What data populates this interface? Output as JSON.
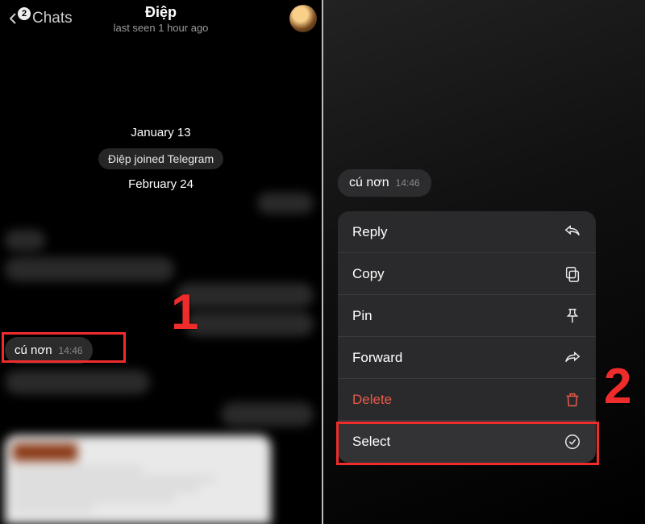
{
  "left": {
    "back_label": "Chats",
    "back_count": "2",
    "title": "Điệp",
    "subtitle": "last seen 1 hour ago",
    "date1": "January 13",
    "joined": "Điệp joined Telegram",
    "date2": "February 24",
    "hi_bubble": {
      "text": "cú nơn",
      "time": "14:46"
    }
  },
  "right": {
    "bubble": {
      "text": "cú nơn",
      "time": "14:46"
    },
    "menu": {
      "reply": "Reply",
      "copy": "Copy",
      "pin": "Pin",
      "forward": "Forward",
      "delete": "Delete",
      "select": "Select"
    }
  },
  "steps": {
    "one": "1",
    "two": "2"
  }
}
